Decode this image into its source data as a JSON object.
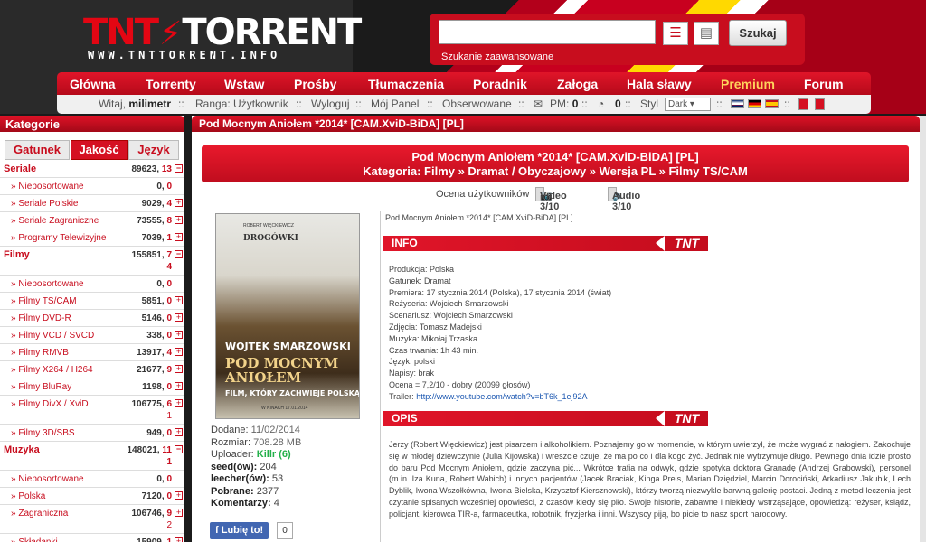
{
  "header": {
    "logo_part1": "TNT",
    "logo_part2": "TORRENT",
    "logo_sub": "WWW.TNTTORRENT.INFO",
    "search_value": "",
    "search_button": "Szukaj",
    "advanced_search": "Szukanie zaawansowane"
  },
  "nav": [
    "Główna",
    "Torrenty",
    "Wstaw",
    "Prośby",
    "Tłumaczenia",
    "Poradnik",
    "Załoga",
    "Hala sławy",
    "Premium",
    "Forum"
  ],
  "userbar": {
    "greeting": "Witaj,",
    "username": "milimetr",
    "rank_label": "Ranga:",
    "rank": "Użytkownik",
    "logout": "Wyloguj",
    "panel": "Mój Panel",
    "watched": "Obserwowane",
    "pm_label": "PM:",
    "pm_count": "0",
    "other_count": "0",
    "style_label": "Styl",
    "style_value": "Dark",
    "sep": "::"
  },
  "sidebar": {
    "title": "Kategorie",
    "tabs": [
      "Gatunek",
      "Jakość",
      "Język"
    ],
    "categories": [
      {
        "name": "Seriale",
        "count": "89623,",
        "new": "13",
        "level": 0,
        "sign": "−"
      },
      {
        "name": "» Nieposortowane",
        "count": "0,",
        "new": "0",
        "level": 1,
        "sign": ""
      },
      {
        "name": "» Seriale Polskie",
        "count": "9029,",
        "new": "4",
        "level": 1,
        "sign": "+"
      },
      {
        "name": "» Seriale Zagraniczne",
        "count": "73555,",
        "new": "8",
        "level": 1,
        "sign": "+"
      },
      {
        "name": "» Programy Telewizyjne",
        "count": "7039,",
        "new": "1",
        "level": 1,
        "sign": "+"
      },
      {
        "name": "Filmy",
        "count": "155851,",
        "new": "7",
        "level": 0,
        "sign": "−",
        "wrap": "4"
      },
      {
        "name": "» Nieposortowane",
        "count": "0,",
        "new": "0",
        "level": 1,
        "sign": ""
      },
      {
        "name": "» Filmy TS/CAM",
        "count": "5851,",
        "new": "0",
        "level": 1,
        "sign": "+"
      },
      {
        "name": "» Filmy DVD-R",
        "count": "5146,",
        "new": "0",
        "level": 1,
        "sign": "+"
      },
      {
        "name": "» Filmy VCD / SVCD",
        "count": "338,",
        "new": "0",
        "level": 1,
        "sign": "+"
      },
      {
        "name": "» Filmy RMVB",
        "count": "13917,",
        "new": "4",
        "level": 1,
        "sign": "+"
      },
      {
        "name": "» Filmy X264 / H264",
        "count": "21677,",
        "new": "9",
        "level": 1,
        "sign": "+"
      },
      {
        "name": "» Filmy BluRay",
        "count": "1198,",
        "new": "0",
        "level": 1,
        "sign": "+"
      },
      {
        "name": "» Filmy DivX / XviD",
        "count": "106775,",
        "new": "6",
        "level": 1,
        "sign": "+",
        "wrap": "1"
      },
      {
        "name": "» Filmy 3D/SBS",
        "count": "949,",
        "new": "0",
        "level": 1,
        "sign": "+"
      },
      {
        "name": "Muzyka",
        "count": "148021,",
        "new": "11",
        "level": 0,
        "sign": "−",
        "wrap": "1"
      },
      {
        "name": "» Nieposortowane",
        "count": "0,",
        "new": "0",
        "level": 1,
        "sign": ""
      },
      {
        "name": "» Polska",
        "count": "7120,",
        "new": "0",
        "level": 1,
        "sign": "+"
      },
      {
        "name": "» Zagraniczna",
        "count": "106746,",
        "new": "9",
        "level": 1,
        "sign": "+",
        "wrap": "2"
      },
      {
        "name": "» Składanki",
        "count": "15909,",
        "new": "1",
        "level": 1,
        "sign": "+"
      }
    ]
  },
  "main": {
    "top_title": "Pod Mocnym Aniołem *2014* [CAM.XviD-BiDA] [PL]",
    "torrent_title": "Pod Mocnym Aniołem *2014* [CAM.XviD-BiDA] [PL]",
    "category_line": "Kategoria: Filmy » Dramat / Obyczajowy » Wersja PL » Filmy TS/CAM",
    "user_rating_label": "Ocena użytkowników",
    "video_rating": "Video 3/10",
    "audio_rating": "Audio 3/10",
    "title_line": "Pod Mocnym Aniołem *2014* [CAM.XviD-BiDA] [PL]",
    "info_header": "INFO",
    "opis_header": "OPIS",
    "tnt_badge": "TNT",
    "info_lines": [
      "Produkcja: Polska",
      "Gatunek: Dramat",
      "Premiera: 17 stycznia 2014 (Polska), 17 stycznia 2014 (świat)",
      "Reżyseria: Wojciech Smarzowski",
      "Scenariusz: Wojciech Smarzowski",
      "Zdjęcia: Tomasz Madejski",
      "Muzyka: Mikołaj Trzaska",
      "Czas trwania: 1h 43 min.",
      "Język: polski",
      "Napisy: brak",
      "Ocena = 7,2/10 - dobry (20099 głosów)"
    ],
    "trailer_label": "Trailer:",
    "trailer_url": "http://www.youtube.com/watch?v=bT6k_1ej92A",
    "description": "Jerzy (Robert Więckiewicz) jest pisarzem i alkoholikiem. Poznajemy go w momencie, w którym uwierzył, że może wygrać z nałogiem. Zakochuje się w młodej dziewczynie (Julia Kijowska) i wreszcie czuje, że ma po co i dla kogo żyć. Jednak nie wytrzymuje długo. Pewnego dnia idzie prosto do baru Pod Mocnym Aniołem, gdzie zaczyna pić... Wkrótce trafia na odwyk, gdzie spotyka doktora Granadę (Andrzej Grabowski), personel (m.in. Iza Kuna, Robert Wabich) i innych pacjentów (Jacek Braciak, Kinga Preis, Marian Dziędziel, Marcin Dorociński, Arkadiusz Jakubik, Lech Dyblik, Iwona Wszołkówna, Iwona Bielska, Krzysztof Kiersznowski), którzy tworzą niezwykle barwną galerię postaci. Jedną z metod leczenia jest czytanie spisanych wcześniej opowieści, z czasów kiedy się piło. Swoje historie, zabawne i niekiedy wstrząsające, opowiedzą: reżyser, ksiądz, policjant, kierowca TIR-a, farmaceutka, robotnik, fryzjerka i inni. Wszyscy piją, bo picie to nasz sport narodowy.",
    "poster": {
      "actor_top": "ROBERT WIĘCKIEWICZ",
      "tagline": "DROGÓWKI",
      "director": "WOJTEK SMARZOWSKI",
      "title1": "POD MOCNYM",
      "title2": "ANIOŁEM",
      "subtitle": "FILM, KTÓRY ZACHWIEJE POLSKĄ",
      "date": "W KINACH 17.01.2014"
    },
    "meta": {
      "added_label": "Dodane:",
      "added": "11/02/2014",
      "size_label": "Rozmiar:",
      "size": "708.28 MB",
      "uploader_label": "Uploader:",
      "uploader": "Killr (6)",
      "seeds_label": "seed(ów):",
      "seeds": "204",
      "leech_label": "leecher(ów):",
      "leech": "53",
      "downloads_label": "Pobrane:",
      "downloads": "2377",
      "comments_label": "Komentarzy:",
      "comments": "4"
    },
    "like_label": "Lubię to!",
    "like_count": "0"
  }
}
